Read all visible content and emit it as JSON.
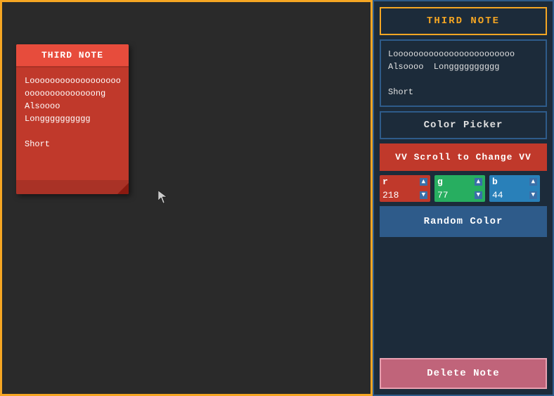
{
  "left": {
    "border_color": "#f5a623"
  },
  "note": {
    "title": "THIRD  NOTE",
    "body_line1": "Loooooooooooooooooo",
    "body_line2": "oooooooooooooong",
    "body_line3": "Alsoooo",
    "body_line4": "Longggggggggg",
    "short_line": "Short"
  },
  "right_panel": {
    "title": "THIRD  NOTE",
    "preview_line1": "Loooooooooooooooooooooooo",
    "preview_line2": "Alsoooo  Longggggggggg",
    "preview_line3": "",
    "preview_line4": "Short",
    "color_picker_label": "Color Picker",
    "scroll_label": "VV  Scroll to Change  VV",
    "rgb": {
      "r_label": "r",
      "r_value": "218",
      "g_label": "g",
      "g_value": "77",
      "b_label": "b",
      "b_value": "44"
    },
    "random_label": "Random  Color",
    "delete_label": "Delete  Note"
  }
}
